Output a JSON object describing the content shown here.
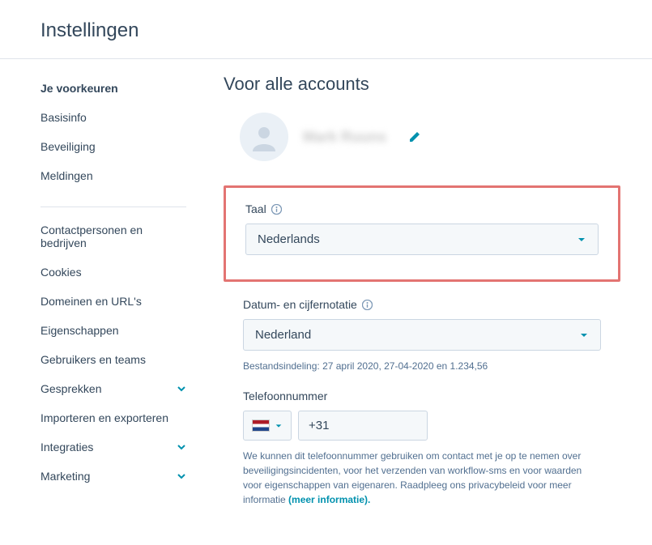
{
  "page_title": "Instellingen",
  "sidebar": {
    "top_heading": "Je voorkeuren",
    "top_items": [
      {
        "label": "Basisinfo",
        "expandable": false
      },
      {
        "label": "Beveiliging",
        "expandable": false
      },
      {
        "label": "Meldingen",
        "expandable": false
      }
    ],
    "bottom_items": [
      {
        "label": "Contactpersonen en bedrijven",
        "expandable": false
      },
      {
        "label": "Cookies",
        "expandable": false
      },
      {
        "label": "Domeinen en URL's",
        "expandable": false
      },
      {
        "label": "Eigenschappen",
        "expandable": false
      },
      {
        "label": "Gebruikers en teams",
        "expandable": false
      },
      {
        "label": "Gesprekken",
        "expandable": true
      },
      {
        "label": "Importeren en exporteren",
        "expandable": false
      },
      {
        "label": "Integraties",
        "expandable": true
      },
      {
        "label": "Marketing",
        "expandable": true
      }
    ]
  },
  "main": {
    "heading": "Voor alle accounts",
    "profile_name": "Mark Ruuns",
    "language": {
      "label": "Taal",
      "value": "Nederlands"
    },
    "date_format": {
      "label": "Datum- en cijfernotatie",
      "value": "Nederland",
      "helper": "Bestandsindeling: 27 april 2020, 27-04-2020 en 1.234,56"
    },
    "phone": {
      "label": "Telefoonnummer",
      "value": "+31",
      "helper": "We kunnen dit telefoonnummer gebruiken om contact met je op te nemen over beveiligingsincidenten, voor het verzenden van workflow-sms en voor waarden voor eigenschappen van eigenaren. Raadpleeg ons privacybeleid voor meer informatie ",
      "link_text": "(meer informatie)."
    }
  }
}
